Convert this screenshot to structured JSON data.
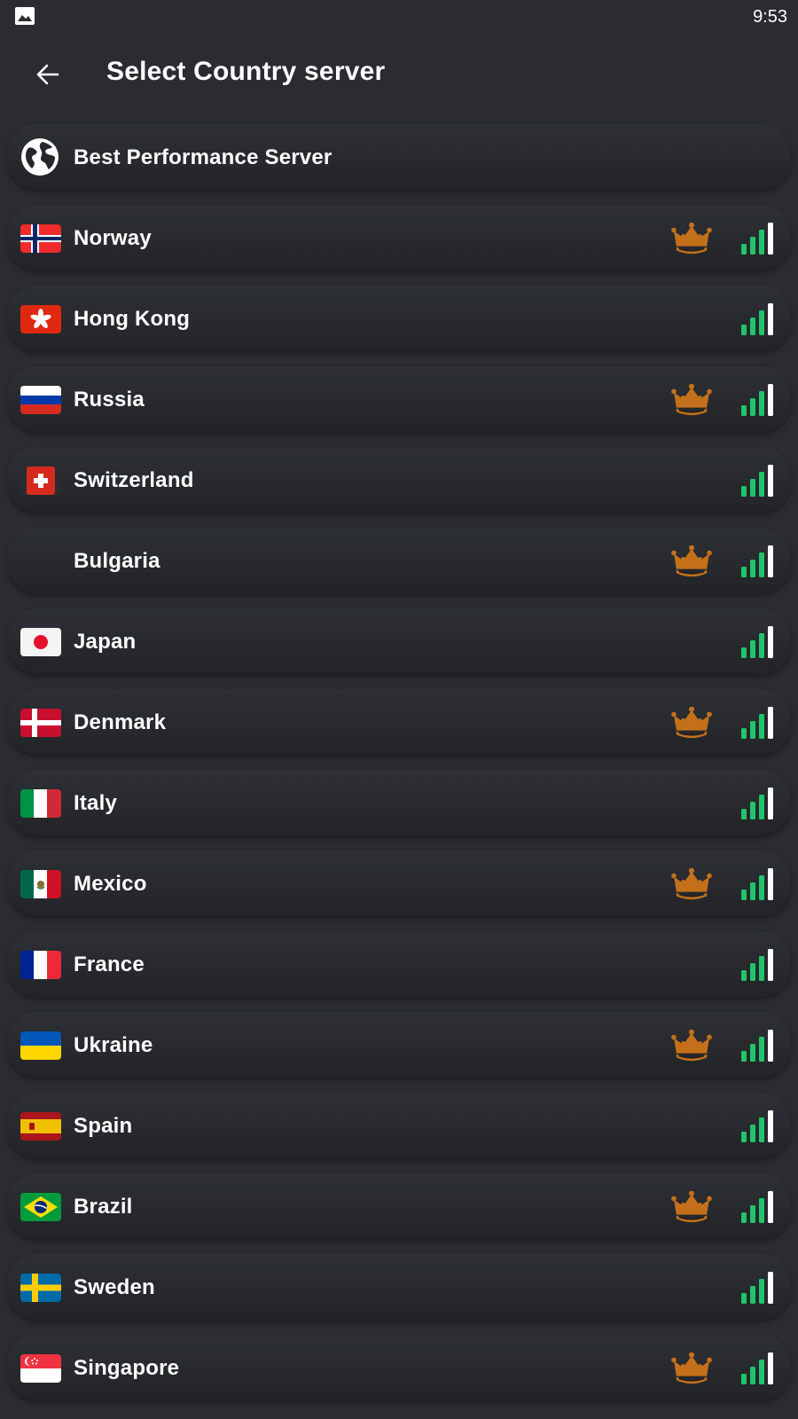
{
  "status_bar": {
    "time": "9:53",
    "notification_icon": "image-icon"
  },
  "header": {
    "title": "Select Country server",
    "back_icon": "arrow-left-icon"
  },
  "best_server": {
    "label": "Best Performance Server",
    "icon": "globe-icon"
  },
  "colors": {
    "background": "#2a2c31",
    "premium_crown": "#c4701a",
    "signal_active": "#21c46a",
    "signal_last": "#ffffff"
  },
  "servers": [
    {
      "label": "Norway",
      "flag": "norway-flag-icon",
      "premium": true,
      "signal_bars": 4
    },
    {
      "label": "Hong Kong",
      "flag": "hong-kong-flag-icon",
      "premium": false,
      "signal_bars": 4
    },
    {
      "label": "Russia",
      "flag": "russia-flag-icon",
      "premium": true,
      "signal_bars": 4
    },
    {
      "label": "Switzerland",
      "flag": "switzerland-flag-icon",
      "premium": false,
      "signal_bars": 4
    },
    {
      "label": "Bulgaria",
      "flag": "",
      "premium": true,
      "signal_bars": 4
    },
    {
      "label": "Japan",
      "flag": "japan-flag-icon",
      "premium": false,
      "signal_bars": 4
    },
    {
      "label": "Denmark",
      "flag": "denmark-flag-icon",
      "premium": true,
      "signal_bars": 4
    },
    {
      "label": "Italy",
      "flag": "italy-flag-icon",
      "premium": false,
      "signal_bars": 4
    },
    {
      "label": "Mexico",
      "flag": "mexico-flag-icon",
      "premium": true,
      "signal_bars": 4
    },
    {
      "label": "France",
      "flag": "france-flag-icon",
      "premium": false,
      "signal_bars": 4
    },
    {
      "label": "Ukraine",
      "flag": "ukraine-flag-icon",
      "premium": true,
      "signal_bars": 4
    },
    {
      "label": "Spain",
      "flag": "spain-flag-icon",
      "premium": false,
      "signal_bars": 4
    },
    {
      "label": "Brazil",
      "flag": "brazil-flag-icon",
      "premium": true,
      "signal_bars": 4
    },
    {
      "label": "Sweden",
      "flag": "sweden-flag-icon",
      "premium": false,
      "signal_bars": 4
    },
    {
      "label": "Singapore",
      "flag": "singapore-flag-icon",
      "premium": true,
      "signal_bars": 4
    }
  ]
}
